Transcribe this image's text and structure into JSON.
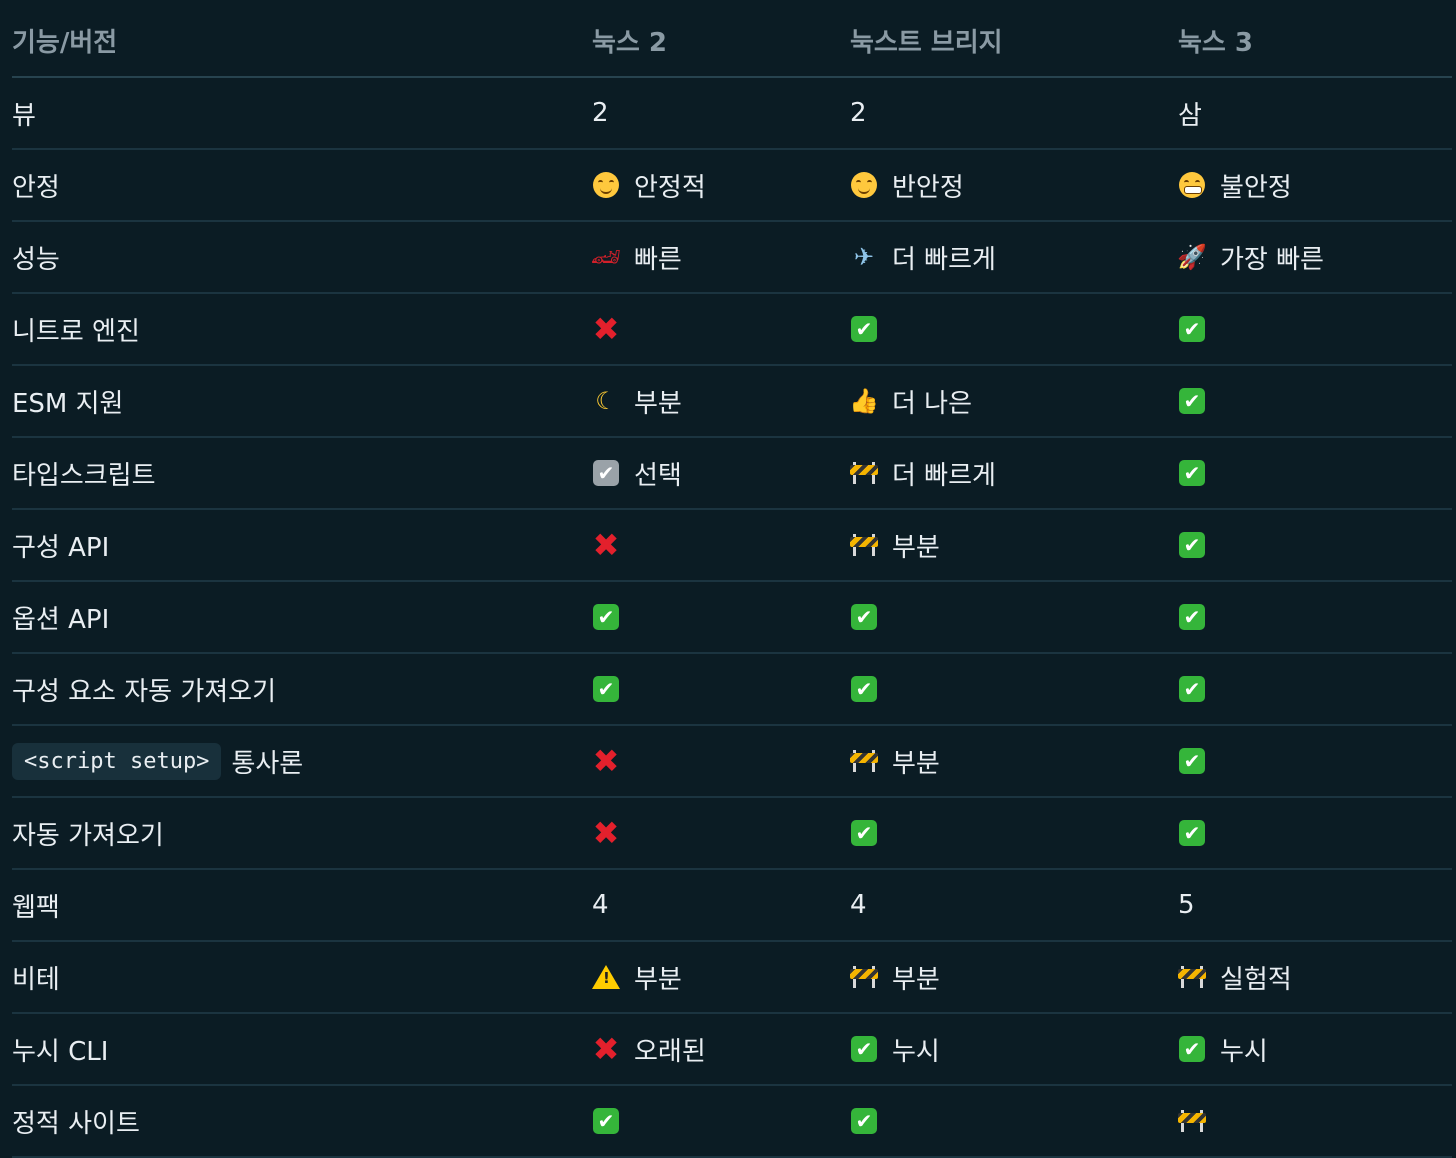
{
  "header": {
    "feature": "기능/버전",
    "nuxt2": "눅스 2",
    "bridge": "눅스트 브리지",
    "nuxt3": "눅스 3"
  },
  "rows": [
    {
      "name": "뷰",
      "nuxt2": {
        "icon": "",
        "text": "2"
      },
      "bridge": {
        "icon": "",
        "text": "2"
      },
      "nuxt3": {
        "icon": "",
        "text": "삼"
      }
    },
    {
      "name": "안정",
      "nuxt2": {
        "icon": "smiling-face-icon",
        "text": "안정적"
      },
      "bridge": {
        "icon": "relieved-face-icon",
        "text": "반안정"
      },
      "nuxt3": {
        "icon": "grimacing-face-icon",
        "text": "불안정"
      }
    },
    {
      "name": "성능",
      "nuxt2": {
        "icon": "race-car-icon",
        "text": "빠른"
      },
      "bridge": {
        "icon": "airplane-icon",
        "text": "더 빠르게"
      },
      "nuxt3": {
        "icon": "rocket-icon",
        "text": "가장 빠른"
      }
    },
    {
      "name": "니트로 엔진",
      "nuxt2": {
        "icon": "cross-mark-icon",
        "text": ""
      },
      "bridge": {
        "icon": "check-mark-icon",
        "text": ""
      },
      "nuxt3": {
        "icon": "check-mark-icon",
        "text": ""
      }
    },
    {
      "name": "ESM 지원",
      "nuxt2": {
        "icon": "crescent-moon-icon",
        "text": "부분"
      },
      "bridge": {
        "icon": "thumbs-up-icon",
        "text": "더 나은"
      },
      "nuxt3": {
        "icon": "check-mark-icon",
        "text": ""
      }
    },
    {
      "name": "타입스크립트",
      "nuxt2": {
        "icon": "checkbox-icon",
        "text": "선택"
      },
      "bridge": {
        "icon": "construction-icon",
        "text": "더 빠르게"
      },
      "nuxt3": {
        "icon": "check-mark-icon",
        "text": ""
      }
    },
    {
      "name": "구성 API",
      "nuxt2": {
        "icon": "cross-mark-icon",
        "text": ""
      },
      "bridge": {
        "icon": "construction-icon",
        "text": "부분"
      },
      "nuxt3": {
        "icon": "check-mark-icon",
        "text": ""
      }
    },
    {
      "name": "옵션 API",
      "nuxt2": {
        "icon": "check-mark-icon",
        "text": ""
      },
      "bridge": {
        "icon": "check-mark-icon",
        "text": ""
      },
      "nuxt3": {
        "icon": "check-mark-icon",
        "text": ""
      }
    },
    {
      "name": "구성 요소 자동 가져오기",
      "nuxt2": {
        "icon": "check-mark-icon",
        "text": ""
      },
      "bridge": {
        "icon": "check-mark-icon",
        "text": ""
      },
      "nuxt3": {
        "icon": "check-mark-icon",
        "text": ""
      }
    },
    {
      "name": "통사론",
      "code": "<script setup>",
      "nuxt2": {
        "icon": "cross-mark-icon",
        "text": ""
      },
      "bridge": {
        "icon": "construction-icon",
        "text": "부분"
      },
      "nuxt3": {
        "icon": "check-mark-icon",
        "text": ""
      }
    },
    {
      "name": "자동 가져오기",
      "nuxt2": {
        "icon": "cross-mark-icon",
        "text": ""
      },
      "bridge": {
        "icon": "check-mark-icon",
        "text": ""
      },
      "nuxt3": {
        "icon": "check-mark-icon",
        "text": ""
      }
    },
    {
      "name": "웹팩",
      "nuxt2": {
        "icon": "",
        "text": "4"
      },
      "bridge": {
        "icon": "",
        "text": "4"
      },
      "nuxt3": {
        "icon": "",
        "text": "5"
      }
    },
    {
      "name": "비테",
      "nuxt2": {
        "icon": "warning-icon",
        "text": "부분"
      },
      "bridge": {
        "icon": "construction-icon",
        "text": "부분"
      },
      "nuxt3": {
        "icon": "construction-icon",
        "text": "실험적"
      }
    },
    {
      "name": "누시 CLI",
      "nuxt2": {
        "icon": "cross-mark-icon",
        "text": "오래된"
      },
      "bridge": {
        "icon": "check-mark-icon",
        "text": "누시"
      },
      "nuxt3": {
        "icon": "check-mark-icon",
        "text": "누시"
      }
    },
    {
      "name": "정적 사이트",
      "nuxt2": {
        "icon": "check-mark-icon",
        "text": ""
      },
      "bridge": {
        "icon": "check-mark-icon",
        "text": ""
      },
      "nuxt3": {
        "icon": "construction-icon",
        "text": ""
      }
    }
  ]
}
